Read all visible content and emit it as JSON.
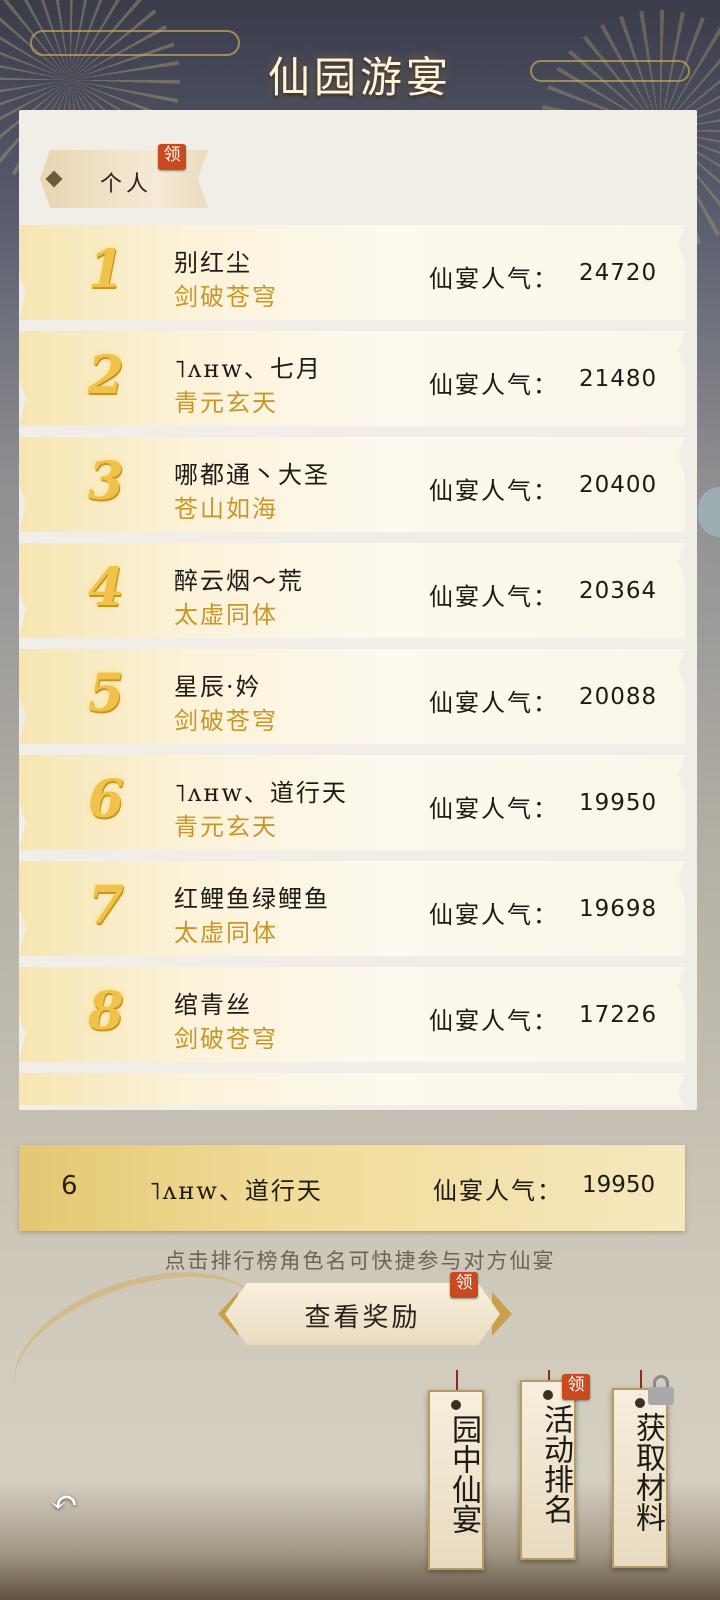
{
  "header": {
    "title": "仙园游宴"
  },
  "tabs": [
    {
      "label": "个人",
      "badge": "领"
    }
  ],
  "leaderboard": {
    "rows": [
      {
        "rank": "1",
        "name": "别红尘",
        "guild": "剑破苍穹",
        "pop_label": "仙宴人气：",
        "pop_value": "24720"
      },
      {
        "rank": "2",
        "name": "˥ʌʜw、七月",
        "guild": "青元玄天",
        "pop_label": "仙宴人气：",
        "pop_value": "21480"
      },
      {
        "rank": "3",
        "name": "哪都通丶大圣",
        "guild": "苍山如海",
        "pop_label": "仙宴人气：",
        "pop_value": "20400"
      },
      {
        "rank": "4",
        "name": "醉云烟～荒",
        "guild": "太虚同体",
        "pop_label": "仙宴人气：",
        "pop_value": "20364"
      },
      {
        "rank": "5",
        "name": "星辰·妗",
        "guild": "剑破苍穹",
        "pop_label": "仙宴人气：",
        "pop_value": "20088"
      },
      {
        "rank": "6",
        "name": "˥ʌʜw、道行天",
        "guild": "青元玄天",
        "pop_label": "仙宴人气：",
        "pop_value": "19950"
      },
      {
        "rank": "7",
        "name": "红鲤鱼绿鲤鱼",
        "guild": "太虚同体",
        "pop_label": "仙宴人气：",
        "pop_value": "19698"
      },
      {
        "rank": "8",
        "name": "绾青丝",
        "guild": "剑破苍穹",
        "pop_label": "仙宴人气：",
        "pop_value": "17226"
      }
    ]
  },
  "my_rank": {
    "rank": "6",
    "name": "˥ʌʜw、道行天",
    "pop_label": "仙宴人气：",
    "pop_value": "19950"
  },
  "hint": "点击排行榜角色名可快捷参与对方仙宴",
  "reward_button": {
    "label": "查看奖励",
    "badge": "领"
  },
  "bottom_tags": [
    {
      "label": "园中仙宴"
    },
    {
      "label": "活动排名",
      "badge": "领"
    },
    {
      "label": "获取材料"
    }
  ],
  "icons": {
    "back": "back-arrow-icon",
    "lock": "lock-icon",
    "tab": "diamond-icon"
  },
  "colors": {
    "accent_gold": "#c99627",
    "badge_red": "#c84a1e",
    "rank_gold": "#f1c24a"
  }
}
